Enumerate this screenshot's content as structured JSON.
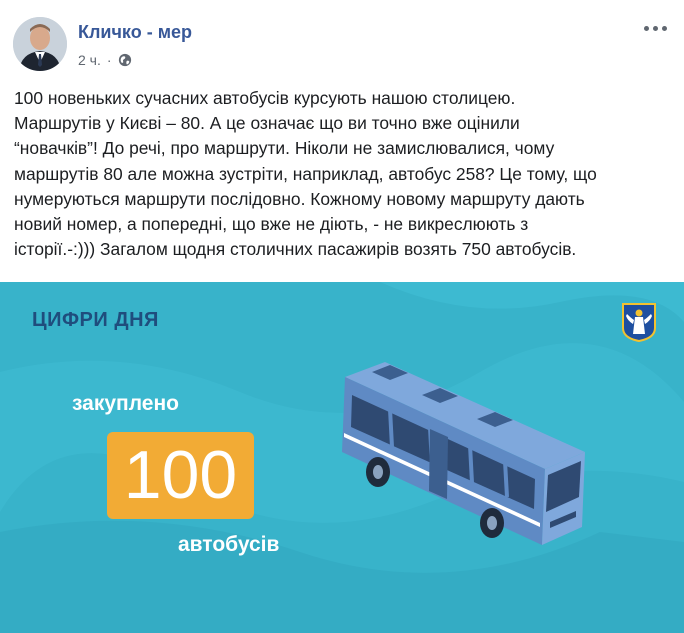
{
  "post": {
    "author_name": "Кличко - мер",
    "timestamp": "2 ч.",
    "privacy_icon": "globe-icon",
    "more_icon": "more-options-icon",
    "text": "100 новеньких сучасних автобусів курсують нашою столицею.\nМаршрутів у Києві – 80. А це означає що ви точно вже оцінили\n“новачків”! До речі, про маршрути. Ніколи не замислювалися, чому\nмаршрутів 80 але можна зустріти, наприклад, автобус 258? Це тому, що\nнумеруються маршрути послідовно. Кожному новому маршруту дають\nновий номер, а попередні, що вже не діють, - не викреслюють з\nісторії.-:))) Загалом щодня столичних пасажирів возять 750 автобусів."
  },
  "infographic": {
    "title": "ЦИФРИ ДНЯ",
    "label_top": "закуплено",
    "number": "100",
    "label_bottom": "автобусів",
    "colors": {
      "background": "#38b3ca",
      "title": "#1f4d7d",
      "number_box": "#f2ab35",
      "bus_body": "#6f98d0"
    }
  }
}
